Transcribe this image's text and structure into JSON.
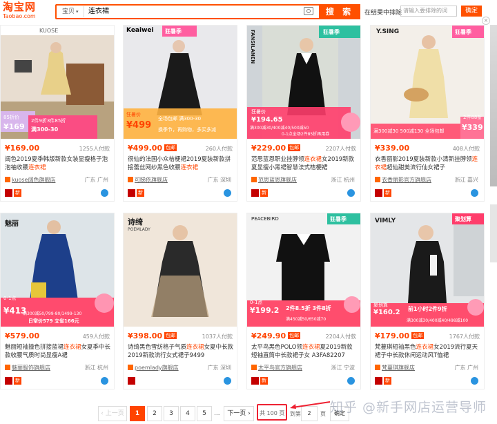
{
  "header": {
    "logo_cn": "淘宝网",
    "logo_en": "Taobao.com",
    "category": "宝贝",
    "query": "连衣裙",
    "search_btn": "搜 索",
    "within_label": "在结果中排除",
    "within_placeholder": "请输入要排除的词",
    "within_btn": "确定",
    "close": "×"
  },
  "products": [
    {
      "brand": "KUOSE",
      "promo": "狂暑季",
      "tag": "85折价",
      "tag2": "2件9折3件85折",
      "tag3": "满300-30",
      "tag4": "¥169",
      "price": "¥169.00",
      "sold": "1255人付款",
      "title_pre": "阔色2019夏季韩版新款女装显瘦格子泡泡袖收腰",
      "title_hl": "连衣裙",
      "title_post": "",
      "shop": "kuose阔色旗舰店",
      "loc": "广东 广州",
      "tm": true
    },
    {
      "brand": "Keaiwei",
      "promo": "狂暑季",
      "tag": "狂暑价",
      "tag2": "¥499",
      "tag3": "全场包邮 满300-30",
      "tag4": "换季节，再购物，多买多减",
      "price": "¥499.00",
      "sold": "260人付款",
      "badge": "包邮",
      "title_pre": "很仙的法国小众桔梗裙2019夏装新款拼接蕾丝网纱黑色收腰",
      "title_hl": "连衣裙",
      "title_post": "",
      "shop": "可睇依旗舰店",
      "loc": "广东 深圳",
      "tm": true
    },
    {
      "brand": "FANSILANEN",
      "promo": "狂暑季",
      "tag": "狂暑价",
      "tag2": "¥194.65",
      "tag3": "满300减30/400减40/500减50",
      "tag4": "0-1点全场2件85折再用券",
      "price": "¥229.00",
      "sold": "2207人付款",
      "badge": "包邮",
      "title_pre": "范思蓝恩职业挂脖领",
      "title_hl": "连衣裙",
      "title_post": "女2019新款夏显瘦小黑裙智慧法式桔梗裙",
      "shop": "范思蓝恩旗舰店",
      "loc": "浙江 杭州",
      "tm": true
    },
    {
      "brand": "Y.SING",
      "promo": "狂暑季",
      "tag": "2件88折",
      "tag2": "¥339",
      "tag3": "满300减30 500减130 全场包邮",
      "tag4": "",
      "price": "¥339.00",
      "sold": "408人付款",
      "title_pre": "衣香丽影2019夏装新款小清新挂脖领",
      "title_hl": "连衣裙",
      "title_post": "超仙甜美流行仙女裙子",
      "shop": "衣香丽影官方旗舰店",
      "loc": "浙江 嘉兴",
      "tm": true
    },
    {
      "brand": "魅丽",
      "promo": "",
      "tag": "0-1点",
      "tag2": "¥413",
      "tag3": "满300减50/799-80/1499-130",
      "tag4": "日常价579 立省166元",
      "price": "¥579.00",
      "sold": "459人付款",
      "title_pre": "魅丽短袖撞色拼接蓝裙",
      "title_hl": "连衣裙",
      "title_post": "女夏季中长款收腰气质时尚显瘦A裙",
      "shop": "魅丽服饰旗舰店",
      "loc": "浙江 杭州",
      "tm": true
    },
    {
      "brand": "诗绮",
      "brand2": "POEMLADY",
      "promo": "",
      "tag": "",
      "tag2": "",
      "tag3": "",
      "tag4": "",
      "price": "¥398.00",
      "sold": "1037人付款",
      "badge": "包邮",
      "title_pre": "诗绮黑色雪纺格子气质",
      "title_hl": "连衣裙",
      "title_post": "女夏中长款2019新款流行女式裙子9499",
      "shop": "poemlady旗舰店",
      "loc": "广东 深圳",
      "tm": true
    },
    {
      "brand": "PEACEBIRD",
      "promo": "狂暑季",
      "tag": "0-1点",
      "tag2": "¥199.2",
      "tag3": "2件8.5折 3件8折",
      "tag4": "满450减50/650减70",
      "price": "¥249.90",
      "sold": "2204人付款",
      "badge": "包邮",
      "title_pre": "太平鸟黑色POLO领",
      "title_hl": "连衣裙",
      "title_post": "夏2019新款短袖直筒中长款裙子女 A3FA82207",
      "shop": "太平鸟官方旗舰店",
      "loc": "浙江 宁波",
      "tm": true
    },
    {
      "brand": "VIMLY",
      "promo": "聚划算",
      "tag": "聚划算",
      "tag2": "¥160.2",
      "tag3": "前1小时2件9折",
      "tag4": "满300减30/400减40/498减100",
      "price": "¥179.00",
      "sold": "1767人付款",
      "badge": "包邮",
      "title_pre": "梵蔓琪短袖黑色",
      "title_hl": "连衣裙",
      "title_post": "女2019流行夏天裙子中长款休闲运动风T恤裙",
      "shop": "梵蔓琪旗舰店",
      "loc": "广东 广州",
      "tm": true
    }
  ],
  "pagination": {
    "prev": "上一页",
    "pages": [
      "1",
      "2",
      "3",
      "4",
      "5"
    ],
    "ellipsis": "...",
    "next": "下一页",
    "total": "共 100 页",
    "goto": "到第",
    "goto_val": "2",
    "page_unit": "页",
    "confirm": "确定"
  },
  "watermark": "知乎 @新手网店运营导师",
  "colors": {
    "accent": "#ff4400",
    "tmall": "#c40000"
  }
}
